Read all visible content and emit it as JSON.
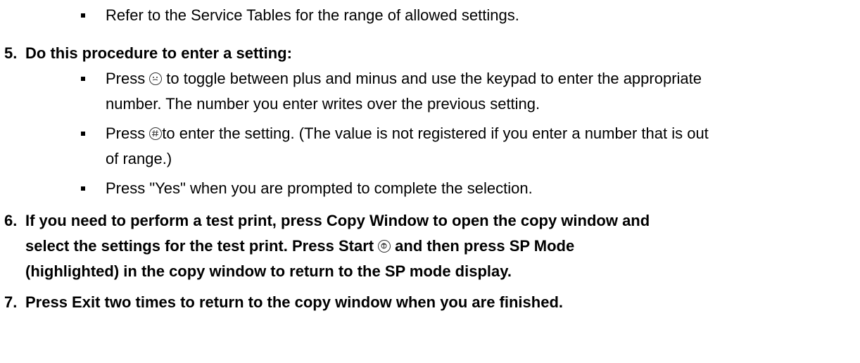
{
  "substep_top": {
    "text": "Refer to the Service Tables for the range of allowed settings."
  },
  "step5": {
    "number": "5.",
    "heading": "Do this procedure to enter a setting:",
    "bullets": {
      "b1_pre": "Press",
      "b1_post": "to toggle between plus and minus and use the keypad to enter the appropriate",
      "b1_line2": "number. The number you enter writes over the previous setting.",
      "b2_pre": "Press",
      "b2_post": "to enter the setting. (The value is not registered if you enter a number that is out",
      "b2_line2": "of range.)",
      "b3": "Press \"Yes\" when you are prompted to complete the selection."
    },
    "icons": [
      "clear-modes-key-icon",
      "hash-key-icon"
    ]
  },
  "step6": {
    "number": "6.",
    "line1": "If you need to perform a test print, press Copy Window to open the copy window and",
    "line2_pre": "select the settings for the test print. Press Start",
    "line2_post": "and then press SP Mode",
    "line3": "(highlighted) in the copy window to return to the SP mode display.",
    "icons": [
      "start-key-icon"
    ]
  },
  "step7": {
    "number": "7.",
    "text": "Press Exit two times to return to the copy window when you are finished."
  }
}
